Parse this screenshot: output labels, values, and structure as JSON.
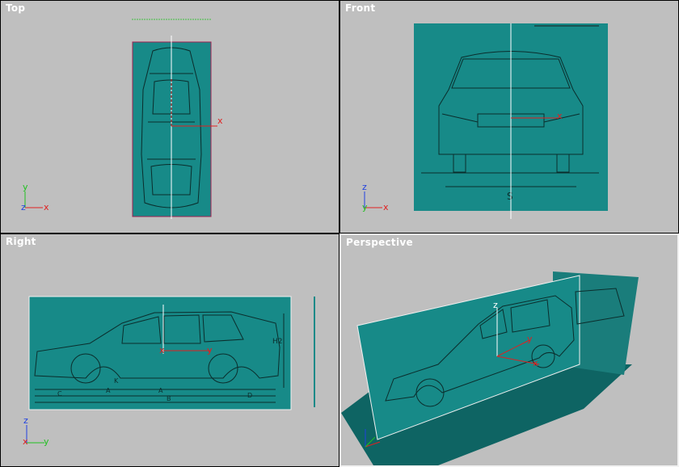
{
  "viewports": {
    "top": {
      "label": "Top"
    },
    "front": {
      "label": "Front"
    },
    "right": {
      "label": "Right"
    },
    "persp": {
      "label": "Perspective"
    }
  },
  "axis_letters": {
    "x": "x",
    "y": "y",
    "z": "z"
  },
  "blueprint_labels": {
    "front_dimension": "S",
    "side_height": "H2",
    "side_dims": [
      "C",
      "A",
      "A",
      "B",
      "D",
      "K"
    ]
  },
  "colors": {
    "viewport_bg": "#bfbfbf",
    "blueprint": "#178a88",
    "axis_x": "#e02020",
    "axis_y": "#20c020",
    "axis_z": "#2040e0"
  }
}
